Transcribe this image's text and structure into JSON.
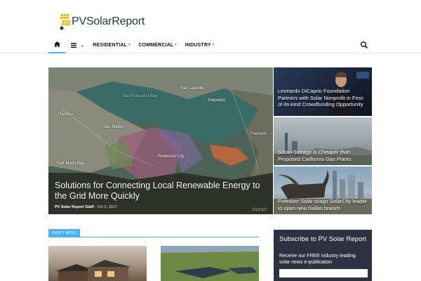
{
  "header": {
    "logo_text": "PVSolarReport",
    "logo_colors": {
      "panel": "#f2b705",
      "text": "#1d3557"
    }
  },
  "nav": {
    "home_icon": "home-icon",
    "menu_icon": "hamburger-menu-icon",
    "items": [
      {
        "label": "RESIDENTIAL"
      },
      {
        "label": "COMMERCIAL"
      },
      {
        "label": "INDUSTRY"
      }
    ],
    "search_icon": "search-icon",
    "accent": "#4db2ec"
  },
  "hero": {
    "map_labels": [
      "San Francisco Bay",
      "Pacifica",
      "San Mateo",
      "Half Moon Bay",
      "Redwood City",
      "Hayward",
      "Fremont",
      "San Leandro"
    ],
    "title": "Solutions for Connecting Local Renewable Energy to the Grid More Quickly",
    "author": "PV Solar Report Staff",
    "date": "Oct 2, 2017",
    "watermark": "SunnyV"
  },
  "side_articles": [
    {
      "title": "Leonardo DiCaprio Foundation Partners with Solar Nonprofit in First-of-its-kind Crowdfunding Opportunity"
    },
    {
      "title": "Solar+Storage is Cheaper than Proposed California Gas Plants"
    },
    {
      "title": "Freedom Solar snags SolarCity leader to open new Dallas branch"
    }
  ],
  "dont_miss": {
    "label": "DON'T MISS"
  },
  "subscribe": {
    "title": "Subscribe to PV Solar Report",
    "text": "Receive our FREE industry leading solar news e-publication"
  }
}
